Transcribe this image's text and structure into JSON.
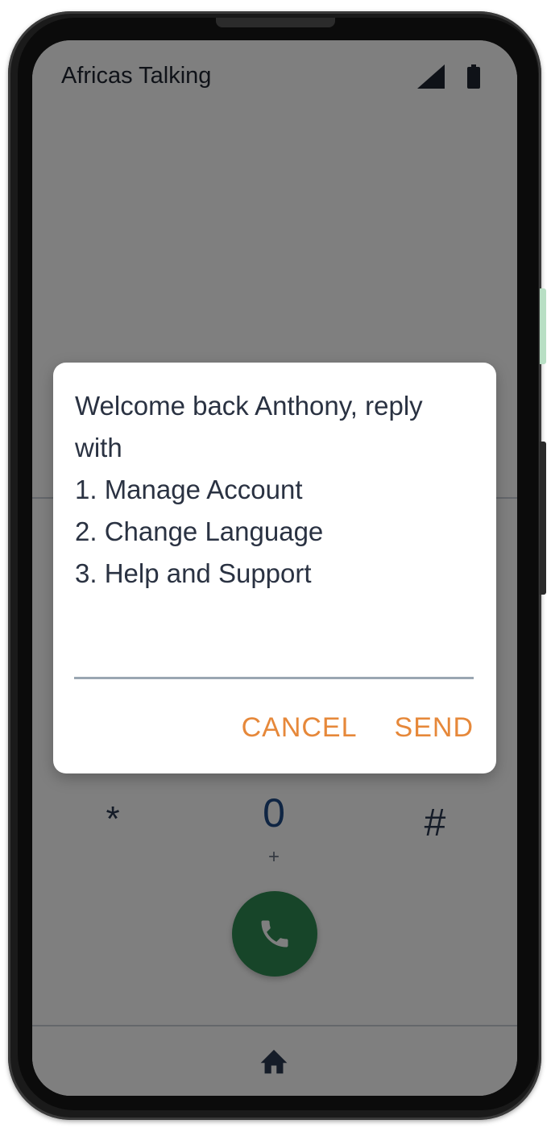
{
  "status_bar": {
    "app_title": "Africas Talking",
    "signal_icon": "cell-signal-icon",
    "battery_icon": "battery-icon"
  },
  "dialer": {
    "key_star": "*",
    "key_zero": "0",
    "key_zero_sub": "+",
    "key_hash": "#",
    "call_icon": "phone-icon",
    "nav_icon": "home-icon",
    "call_color": "#2f8a52"
  },
  "dialog": {
    "message": "Welcome back Anthony, reply\nwith\n1. Manage Account\n2. Change Language\n3. Help and Support",
    "input_value": "",
    "cancel_label": "CANCEL",
    "send_label": "SEND",
    "accent_color": "#e6883a"
  }
}
